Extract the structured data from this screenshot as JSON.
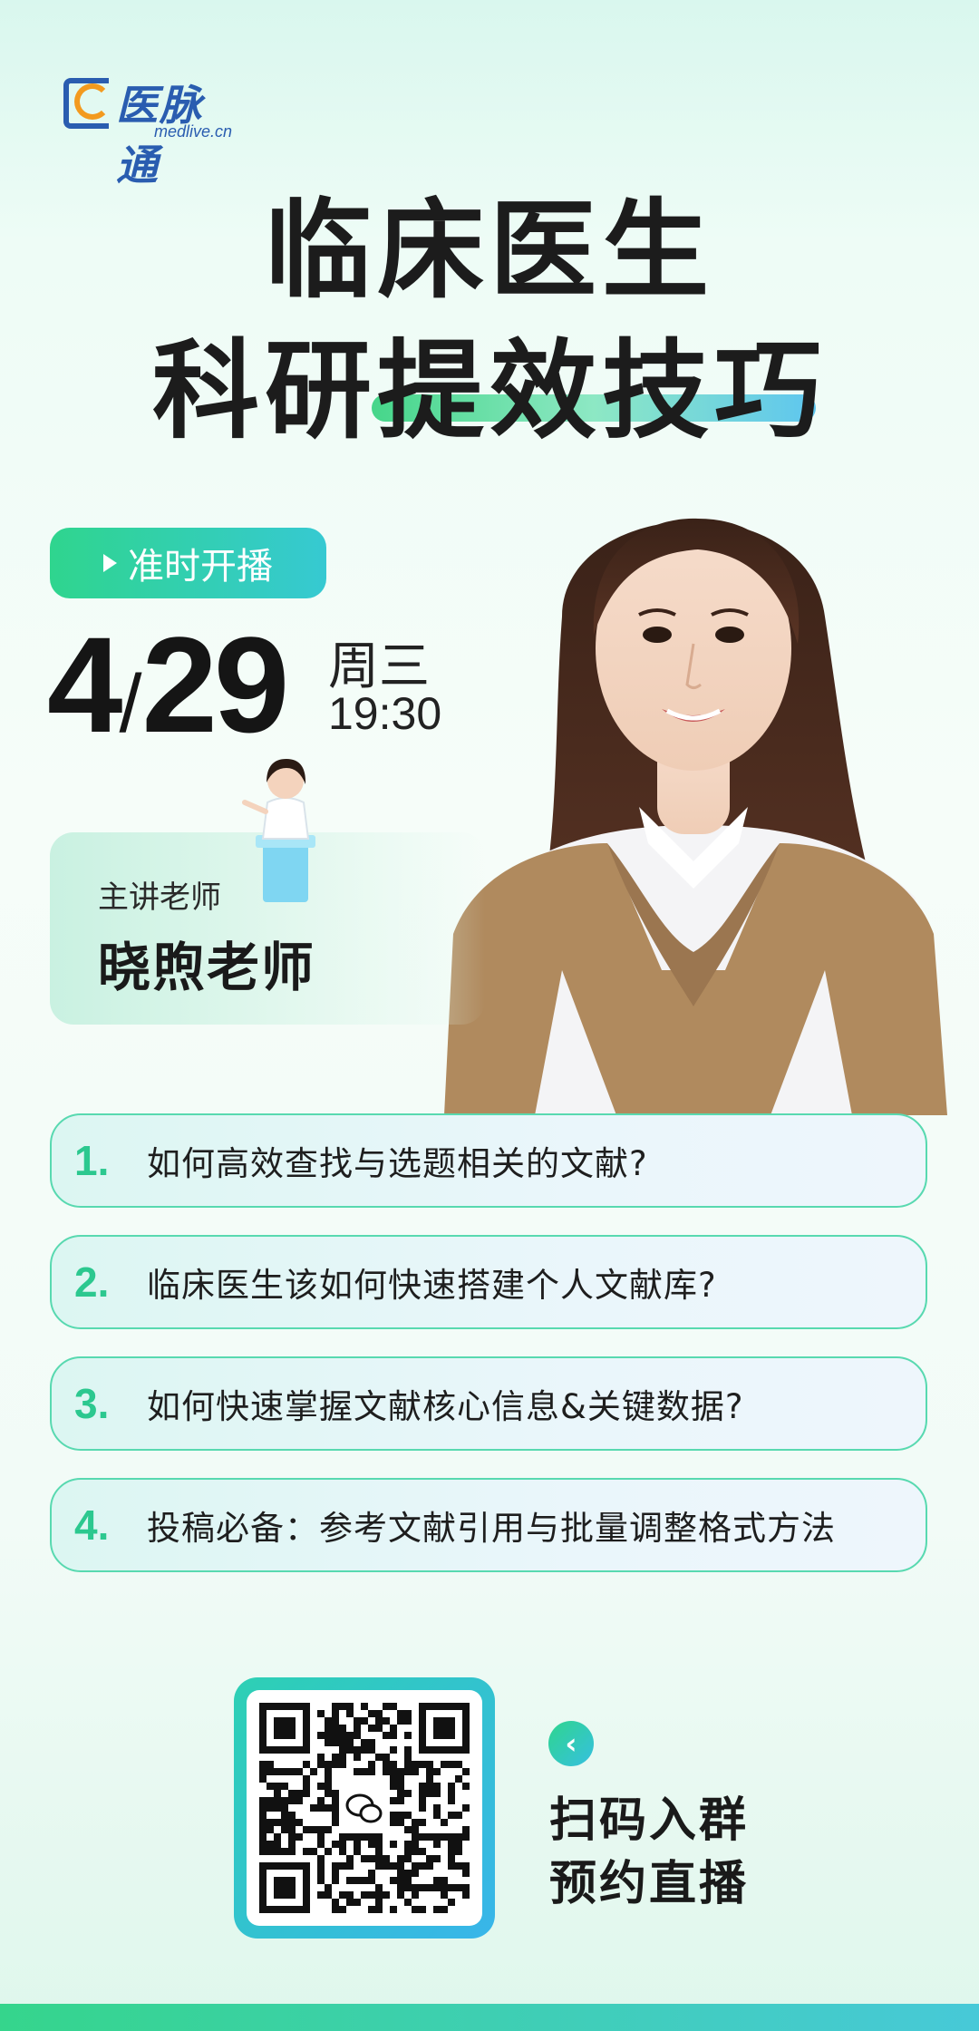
{
  "brand": {
    "logo_text": "医脉通",
    "logo_sub": "medlive.cn"
  },
  "title": {
    "line1": "临床医生",
    "line2": "科研提效技巧"
  },
  "badge": {
    "label": "准时开播"
  },
  "event": {
    "date_month": "4",
    "date_sep": "/",
    "date_day": "29",
    "weekday": "周三",
    "time": "19:30"
  },
  "teacher": {
    "label": "主讲老师",
    "name": "晓煦老师"
  },
  "topics": [
    {
      "num": "1.",
      "text": "如何高效查找与选题相关的文献?"
    },
    {
      "num": "2.",
      "text": "临床医生该如何快速搭建个人文献库?"
    },
    {
      "num": "3.",
      "text": "如何快速掌握文献核心信息&关键数据?"
    },
    {
      "num": "4.",
      "text": "投稿必备：参考文献引用与批量调整格式方法"
    }
  ],
  "cta": {
    "arrow": "‹",
    "line1": "扫码入群",
    "line2": "预约直播"
  },
  "colors": {
    "accent_green": "#2cc88f",
    "accent_blue": "#38b5ea",
    "brand_blue": "#2a5db0"
  }
}
